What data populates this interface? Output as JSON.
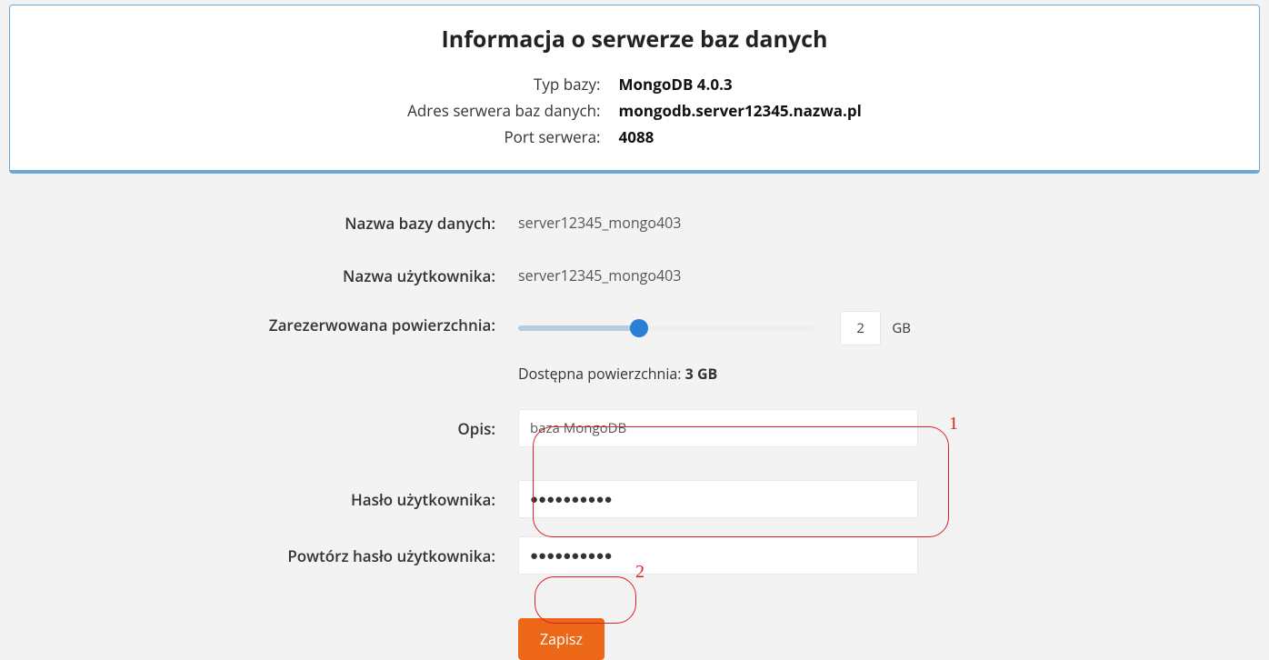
{
  "info": {
    "title": "Informacja o serwerze baz danych",
    "dbTypeLabel": "Typ bazy:",
    "dbTypeValue": "MongoDB 4.0.3",
    "addressLabel": "Adres serwera baz danych:",
    "addressValue": "mongodb.server12345.nazwa.pl",
    "portLabel": "Port serwera:",
    "portValue": "4088"
  },
  "form": {
    "dbNameLabel": "Nazwa bazy danych:",
    "dbNameValue": "server12345_mongo403",
    "userNameLabel": "Nazwa użytkownika:",
    "userNameValue": "server12345_mongo403",
    "reservedLabel": "Zarezerwowana powierzchnia:",
    "reservedValue": "2",
    "reservedUnit": "GB",
    "availableTextPrefix": "Dostępna powierzchnia: ",
    "availableValue": "3 GB",
    "descLabel": "Opis:",
    "descValue": "baza MongoDB",
    "passwordLabel": "Hasło użytkownika:",
    "passwordMask": "●●●●●●●●●●",
    "passwordConfirmLabel": "Powtórz hasło użytkownika:",
    "passwordConfirmMask": "●●●●●●●●●●",
    "saveButton": "Zapisz"
  },
  "callouts": {
    "one": "1",
    "two": "2"
  }
}
